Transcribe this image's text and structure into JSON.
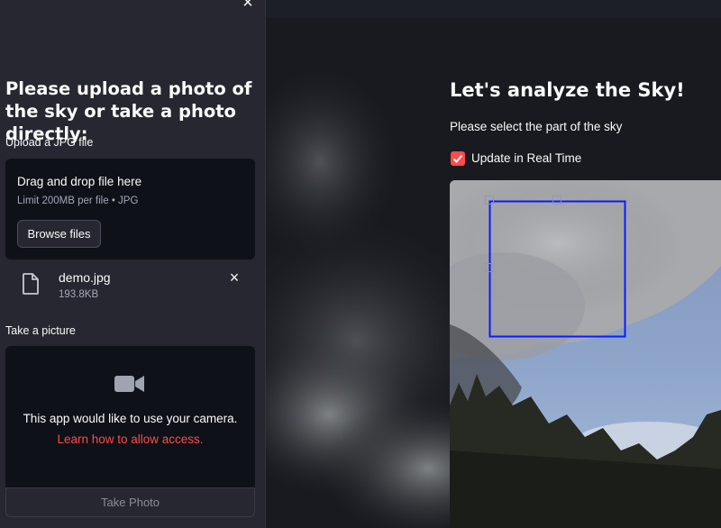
{
  "sidebar": {
    "close_icon": "close-icon",
    "title": "Please upload a photo of the sky or take a photo directly:",
    "upload": {
      "label": "Upload a JPG file",
      "drag_text": "Drag and drop file here",
      "limit_text": "Limit 200MB per file • JPG",
      "browse_label": "Browse files"
    },
    "file": {
      "icon": "file-icon",
      "name": "demo.jpg",
      "size": "193.8KB",
      "remove_icon": "close-icon"
    },
    "camera": {
      "label": "Take a picture",
      "icon": "video-camera-icon",
      "message": "This app would like to use your camera.",
      "link_text": "Learn how to allow access.",
      "take_photo_label": "Take Photo"
    }
  },
  "main": {
    "title": "Let's analyze the Sky!",
    "subtitle": "Please select the part of the sky",
    "realtime_checkbox": {
      "label": "Update in Real Time",
      "checked": true
    },
    "image": {
      "description_icon": "sky-photo"
    }
  },
  "colors": {
    "sidebar_bg": "#262730",
    "main_bg": "#0e1117",
    "accent": "#ff4b4b",
    "crop_box": "#0a1aff",
    "text": "#fafafa",
    "muted_text": "#a3a8b8"
  }
}
